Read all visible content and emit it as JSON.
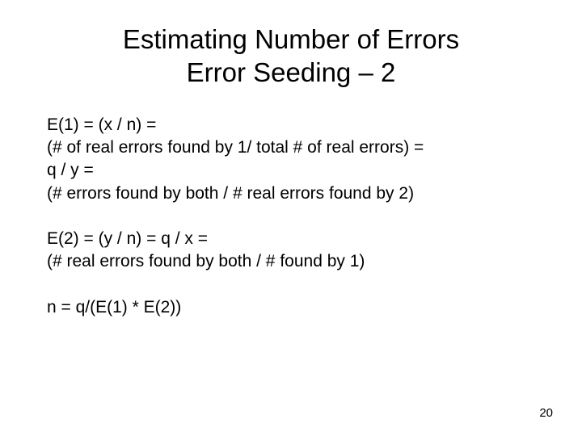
{
  "title_line1": "Estimating Number of Errors",
  "title_line2": "Error Seeding – 2",
  "block1": {
    "line1": "E(1) = (x / n) =",
    "line2": "(# of real errors found by 1/ total # of real errors) =",
    "line3": "q / y =",
    "line4": "(# errors found by both / # real errors found by 2)"
  },
  "block2": {
    "line1": "E(2) = (y / n) = q / x =",
    "line2": "(# real errors found by both / # found by 1)"
  },
  "block3": {
    "line1": "n = q/(E(1) * E(2))"
  },
  "page_number": "20"
}
